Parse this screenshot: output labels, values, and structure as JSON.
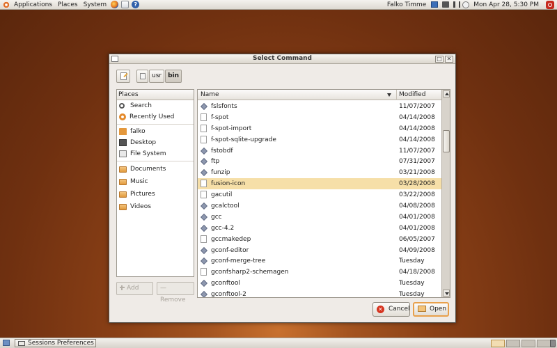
{
  "top_panel": {
    "menus": [
      "Applications",
      "Places",
      "System"
    ],
    "user": "Falko Timme",
    "clock": "Mon Apr 28,  5:30 PM"
  },
  "dialog": {
    "title": "Select Command",
    "path": [
      "usr",
      "bin"
    ],
    "places_header": "Places",
    "places": [
      "Search",
      "Recently Used",
      "falko",
      "Desktop",
      "File System",
      "Documents",
      "Music",
      "Pictures",
      "Videos"
    ],
    "add_label": "Add",
    "remove_label": "Remove",
    "columns": {
      "name": "Name",
      "modified": "Modified"
    },
    "files": [
      {
        "name": "fslsfonts",
        "modified": "11/07/2007",
        "icon": "executable-icon"
      },
      {
        "name": "f-spot",
        "modified": "04/14/2008",
        "icon": "document-icon"
      },
      {
        "name": "f-spot-import",
        "modified": "04/14/2008",
        "icon": "document-icon"
      },
      {
        "name": "f-spot-sqlite-upgrade",
        "modified": "04/14/2008",
        "icon": "document-icon"
      },
      {
        "name": "fstobdf",
        "modified": "11/07/2007",
        "icon": "executable-icon"
      },
      {
        "name": "ftp",
        "modified": "07/31/2007",
        "icon": "executable-icon"
      },
      {
        "name": "funzip",
        "modified": "03/21/2008",
        "icon": "executable-icon"
      },
      {
        "name": "fusion-icon",
        "modified": "03/28/2008",
        "icon": "document-icon",
        "selected": true
      },
      {
        "name": "gacutil",
        "modified": "03/22/2008",
        "icon": "document-icon"
      },
      {
        "name": "gcalctool",
        "modified": "04/08/2008",
        "icon": "executable-icon"
      },
      {
        "name": "gcc",
        "modified": "04/01/2008",
        "icon": "executable-icon"
      },
      {
        "name": "gcc-4.2",
        "modified": "04/01/2008",
        "icon": "executable-icon"
      },
      {
        "name": "gccmakedep",
        "modified": "06/05/2007",
        "icon": "document-icon"
      },
      {
        "name": "gconf-editor",
        "modified": "04/09/2008",
        "icon": "executable-icon"
      },
      {
        "name": "gconf-merge-tree",
        "modified": "Tuesday",
        "icon": "executable-icon"
      },
      {
        "name": "gconfsharp2-schemagen",
        "modified": "04/18/2008",
        "icon": "document-icon"
      },
      {
        "name": "gconftool",
        "modified": "Tuesday",
        "icon": "executable-icon"
      },
      {
        "name": "gconftool-2",
        "modified": "Tuesday",
        "icon": "executable-icon"
      }
    ],
    "cancel_label": "Cancel",
    "open_label": "Open"
  },
  "bottom_panel": {
    "task": "Sessions Preferences"
  }
}
